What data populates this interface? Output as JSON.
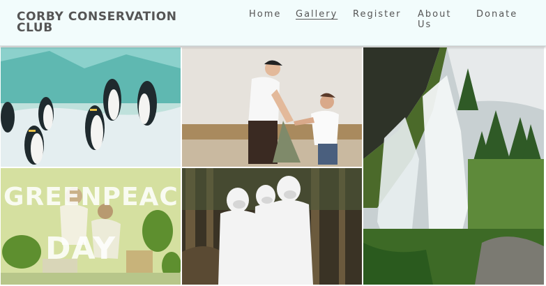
{
  "site": {
    "name": "CORBY CONSERVATION CLUB"
  },
  "nav": {
    "items": [
      {
        "label": "Home",
        "active": false
      },
      {
        "label": "Gallery",
        "active": true
      },
      {
        "label": "Register",
        "active": false
      },
      {
        "label": "About Us",
        "active": false
      },
      {
        "label": "Donate",
        "active": false
      }
    ]
  },
  "gallery": {
    "images": [
      {
        "subject": "penguins on ice"
      },
      {
        "subject": "volunteers picking up litter"
      },
      {
        "subject": "waterfall with pine forest"
      },
      {
        "subject": "people potting plants",
        "overlay_line1": "GREENPEACE",
        "overlay_line2": "DAY"
      },
      {
        "subject": "people in white protective suits in forest"
      }
    ]
  },
  "colors": {
    "header_bg": "#f2fcfc",
    "text": "#555555"
  }
}
